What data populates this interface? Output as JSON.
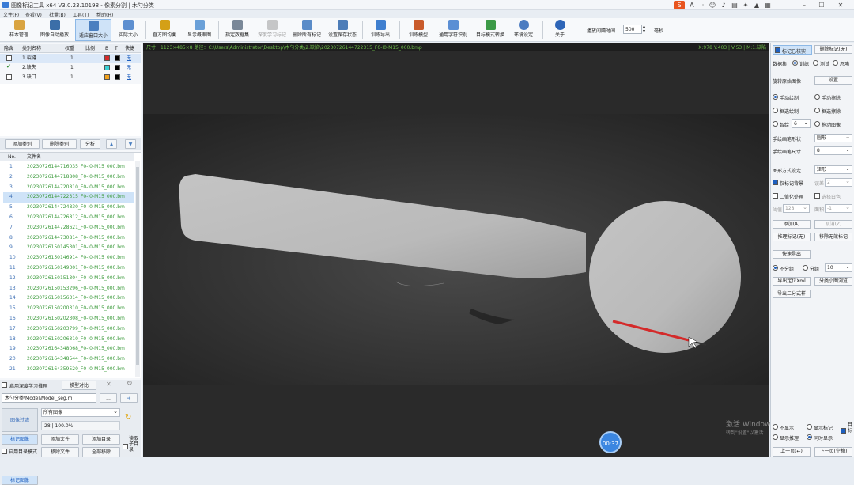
{
  "window": {
    "title": "图像标记工具 x64 V3.0.23.10198 - 像素分割 | 木勺分类"
  },
  "menu": [
    "文件(F)",
    "查看(V)",
    "批量(B)",
    "工具(T)",
    "帮助(H)"
  ],
  "toolbar": {
    "items": [
      "样本管理",
      "图像自动播放",
      "适应窗口大小",
      "实际大小",
      "直方图均衡",
      "显示概率图",
      "指定数据集",
      "深度学习标记",
      "删除所有标记",
      "设置保存状态",
      "训练导出",
      "训练模型",
      "通用字符识别",
      "目标模式转换",
      "环境设定",
      "关于"
    ],
    "interval_label": "播放间隔时间",
    "interval_value": "500",
    "interval_unit": "毫秒"
  },
  "categories": {
    "headers": [
      "隐含",
      "类别名称",
      "权重",
      "比例",
      "B",
      "T",
      "快捷"
    ],
    "rows": [
      {
        "name": "1.裂缝",
        "weight": "1",
        "color": "#d42a2a",
        "shortcut": "无",
        "checked": false
      },
      {
        "name": "2.缺失",
        "weight": "1",
        "color": "#39d0d6",
        "shortcut": "无",
        "checked": true
      },
      {
        "name": "3.缺口",
        "weight": "1",
        "color": "#f2a21c",
        "shortcut": "无",
        "checked": false
      }
    ]
  },
  "cat_buttons": [
    "添加类别",
    "删除类别",
    "分析"
  ],
  "files": {
    "headers": [
      "No.",
      "文件名"
    ],
    "rows": [
      {
        "no": "1",
        "name": "20230726144716035_F0-I0-M15_000.bm"
      },
      {
        "no": "2",
        "name": "20230726144718808_F0-I0-M15_000.bm"
      },
      {
        "no": "3",
        "name": "20230726144720810_F0-I0-M15_000.bm"
      },
      {
        "no": "4",
        "name": "20230726144722315_F0-I0-M15_000.bm"
      },
      {
        "no": "5",
        "name": "20230726144724830_F0-I0-M15_000.bm"
      },
      {
        "no": "6",
        "name": "20230726144726812_F0-I0-M15_000.bm"
      },
      {
        "no": "7",
        "name": "20230726144728621_F0-I0-M15_000.bm"
      },
      {
        "no": "8",
        "name": "20230726144730814_F0-I0-M15_000.bm"
      },
      {
        "no": "9",
        "name": "20230726150145301_F0-I0-M15_000.bm"
      },
      {
        "no": "10",
        "name": "20230726150146914_F0-I0-M15_000.bm"
      },
      {
        "no": "11",
        "name": "20230726150149301_F0-I0-M15_000.bm"
      },
      {
        "no": "12",
        "name": "20230726150151304_F0-I0-M15_000.bm"
      },
      {
        "no": "13",
        "name": "20230726150153296_F0-I0-M15_000.bm"
      },
      {
        "no": "14",
        "name": "20230726150156314_F0-I0-M15_000.bm"
      },
      {
        "no": "15",
        "name": "20230726150200310_F0-I0-M15_000.bm"
      },
      {
        "no": "16",
        "name": "20230726150202308_F0-I0-M15_000.bm"
      },
      {
        "no": "17",
        "name": "20230726150203799_F0-I0-M15_000.bm"
      },
      {
        "no": "18",
        "name": "20230726150206310_F0-I0-M15_000.bm"
      },
      {
        "no": "19",
        "name": "20230726164348068_F0-I0-M15_000.bm"
      },
      {
        "no": "20",
        "name": "20230726164348544_F0-I0-M15_000.bm"
      },
      {
        "no": "21",
        "name": "20230726164359520_F0-I0-M15_000.bm"
      }
    ]
  },
  "bottom_left": {
    "deep_infer": "启用深度学习推理",
    "model_compare": "模型对比",
    "model_path": "木勺分类\\Model\\Model_seg.m",
    "browse": "...",
    "filter_label": "图像过滤",
    "filter_value": "所有图像",
    "count": "28 | 100.0%",
    "mark_image": "标记图像",
    "add_file": "添加文件",
    "add_dir": "添加目录",
    "dir_mode": "启用目录模式",
    "remove_file": "移除文件",
    "remove_all": "全部移除",
    "read_subdir": "读取子目录"
  },
  "infobar": {
    "left": "尺寸：1123×485×8   路径：C:\\Users\\Administrator\\Desktop\\木勺分类\\2.缺陷\\20230726144722315_F0-I0-M15_000.bmp",
    "right": "X:978 Y:403 | V:53 | M:1.缺陷"
  },
  "right": {
    "mark_checked": "标记已核实",
    "delete_mark": "删除标记(无)",
    "dataset": "数据集",
    "train": "训练",
    "test": "测试",
    "ignore": "忽略",
    "rotate": "旋转原始图像",
    "settings": "设置",
    "manual_draw": "手动绘制",
    "manual_erase": "手动擦除",
    "box_draw": "框选绘制",
    "box_erase": "框选擦除",
    "smart": "智绘",
    "smart_val": "6",
    "drag_image": "拖动图像",
    "brush_shape_label": "手绘画笔形状",
    "brush_shape": "圆形",
    "brush_size_label": "手绘画笔尺寸",
    "brush_size": "8",
    "shape_mode_label": "图形方式设定",
    "shape_mode": "矩形",
    "only_bg": "仅标记背景",
    "tol_label": "误差",
    "tol_val": "2",
    "binarize": "二值化处理",
    "pick_white": "选择白色",
    "thresh_label": "阈值",
    "thresh_val": "128",
    "area_label": "面积",
    "area_val": "-1",
    "add": "添加(A)",
    "cancel": "取消(Z)",
    "infer_mark": "推理标记(无)",
    "remove_invalid": "移除无效标记",
    "quick_export": "快速导出",
    "no_group": "不分组",
    "group": "分组",
    "group_val": "10",
    "export_xml": "导出定位Xml",
    "thumb_browse": "分类小图浏览",
    "export_binary": "导出二分式样",
    "hide": "不显示",
    "show_mark": "显示标记",
    "show_infer": "显示推理",
    "show_both": "同时显示",
    "target_label": "目标",
    "prev": "上一页(←)",
    "next": "下一页(空格)",
    "watermark1": "激活 Windows",
    "watermark2": "转到\"设置\"以激活"
  },
  "clock": "00:37",
  "colors": {
    "accent": "#1e5fbf",
    "mark": "#d42a2a"
  }
}
